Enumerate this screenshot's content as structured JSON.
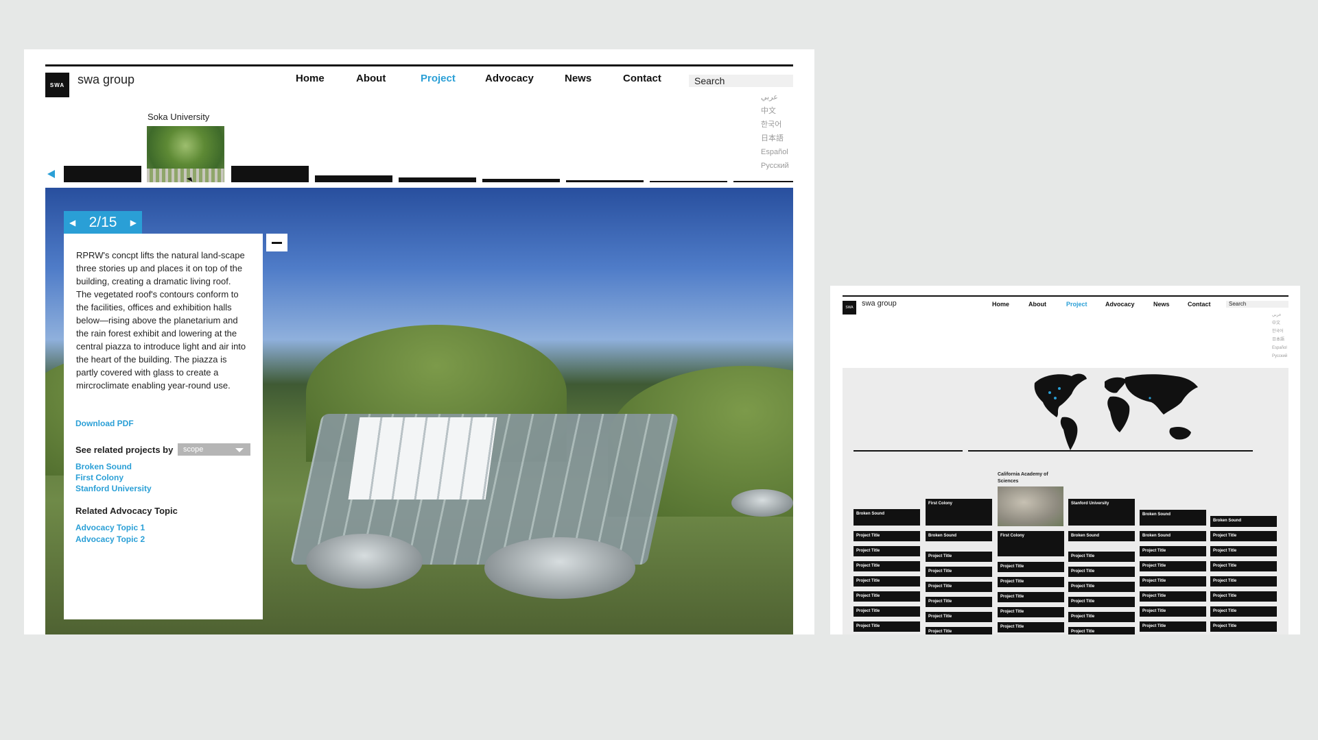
{
  "main": {
    "logo_mark": "SWA",
    "logo_text": "swa group",
    "nav": [
      {
        "label": "Home",
        "active": false
      },
      {
        "label": "About",
        "active": false
      },
      {
        "label": "Project",
        "active": true
      },
      {
        "label": "Advocacy",
        "active": false
      },
      {
        "label": "News",
        "active": false
      },
      {
        "label": "Contact",
        "active": false
      }
    ],
    "search_placeholder": "Search",
    "languages": [
      "عربي",
      "中文",
      "한국어",
      "日本語",
      "Español",
      "Русский"
    ],
    "thumbnail_title": "Soka University",
    "counter": {
      "text": "2/15",
      "prev": "◀",
      "next": "▶"
    },
    "description": "RPRW's concpt lifts the natural land-scape three stories up and places it on top of the building, creating a dramatic living roof. The vegetated roof's contours conform to the facilities, offices and exhibition halls below—rising above the planetarium and the rain forest exhibit and lowering at the central piazza to introduce light and air into the heart of the building. The piazza is partly covered with glass to create a mircroclimate enabling year-round use.",
    "download_label": "Download PDF",
    "related_label": "See related projects by",
    "related_select": "scope",
    "related_projects": [
      "Broken Sound",
      "First Colony",
      "Stanford University"
    ],
    "advocacy_label": "Related Advocacy Topic",
    "advocacy_topics": [
      "Advocacy Topic 1",
      "Advocacy Topic 2"
    ]
  },
  "side": {
    "logo_mark": "SWA",
    "logo_text": "swa group",
    "nav": [
      {
        "label": "Home",
        "active": false
      },
      {
        "label": "About",
        "active": false
      },
      {
        "label": "Project",
        "active": true
      },
      {
        "label": "Advocacy",
        "active": false
      },
      {
        "label": "News",
        "active": false
      },
      {
        "label": "Contact",
        "active": false
      }
    ],
    "search_placeholder": "Search",
    "languages": [
      "عربي",
      "中文",
      "한국어",
      "日本語",
      "Español",
      "Русский"
    ],
    "featured_title": "California Academy of Sciences",
    "columns": [
      [
        "Broken Sound",
        "Project Title",
        "Project Title",
        "Project Title",
        "Project Title",
        "Project Title",
        "Project Title",
        "Project Title"
      ],
      [
        "First Colony",
        "Broken Sound",
        "Project Title",
        "Project Title",
        "Project Title",
        "Project Title",
        "Project Title",
        "Project Title"
      ],
      [
        "First Colony",
        "Project Title",
        "Project Title",
        "Project Title",
        "Project Title",
        "Project Title"
      ],
      [
        "Stanford University",
        "Broken Sound",
        "Project Title",
        "Project Title",
        "Project Title",
        "Project Title",
        "Project Title",
        "Project Title"
      ],
      [
        "Broken Sound",
        "Broken Sound",
        "Project Title",
        "Project Title",
        "Project Title",
        "Project Title",
        "Project Title",
        "Project Title"
      ],
      [
        "Broken Sound",
        "Project Title",
        "Project Title",
        "Project Title",
        "Project Title",
        "Project Title",
        "Project Title",
        "Project Title"
      ]
    ]
  },
  "colors": {
    "accent": "#2a9fd6",
    "ink": "#111111",
    "backdrop": "#e6e8e7"
  }
}
